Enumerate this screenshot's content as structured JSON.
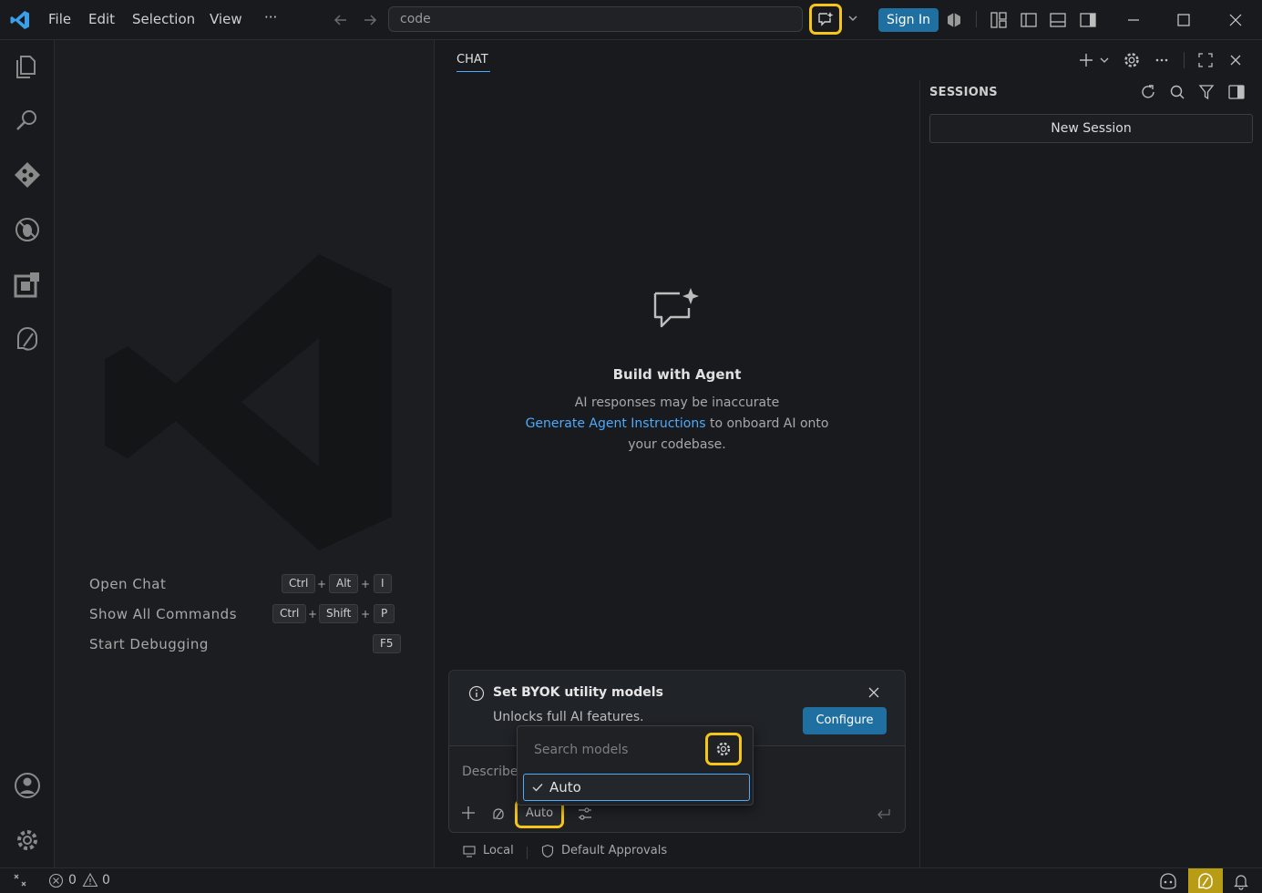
{
  "titlebar": {
    "menu": [
      "File",
      "Edit",
      "Selection",
      "View",
      "···"
    ],
    "search_text": "code",
    "sign_in_label": "Sign In"
  },
  "activity_bar": {
    "items": [
      "explorer-icon",
      "search-icon",
      "source-control-icon",
      "run-debug-icon",
      "extensions-icon",
      "copilot-icon"
    ],
    "bottom": [
      "account-icon",
      "manage-gear-icon"
    ]
  },
  "editor": {
    "shortcuts": [
      {
        "label": "Open Chat",
        "keys": [
          "Ctrl",
          "Alt",
          "I"
        ]
      },
      {
        "label": "Show All Commands",
        "keys": [
          "Ctrl",
          "Shift",
          "P"
        ]
      },
      {
        "label": "Start Debugging",
        "keys": [
          "F5"
        ]
      }
    ],
    "plus": "+"
  },
  "chat": {
    "tab_label": "CHAT",
    "empty_title": "Build with Agent",
    "empty_line1": "AI responses may be inaccurate",
    "empty_link": "Generate Agent Instructions",
    "empty_line2_rest": " to onboard AI onto",
    "empty_line3": "your codebase.",
    "notice": {
      "title": "Set BYOK utility models",
      "subtitle": "Unlocks full AI features.",
      "button": "Configure"
    },
    "input_placeholder": "Describe",
    "mode_label": "Auto",
    "model_picker": {
      "search_placeholder": "Search models",
      "options": [
        {
          "label": "Auto",
          "selected": true
        }
      ]
    },
    "footer": {
      "location": "Local",
      "approvals": "Default Approvals"
    }
  },
  "sessions": {
    "title": "SESSIONS",
    "new_session_label": "New Session"
  },
  "statusbar": {
    "errors": "0",
    "warnings": "0"
  },
  "colors": {
    "accent": "#4daafc",
    "button": "#1f6fa0",
    "highlight": "#f5c518",
    "background": "#181a1d"
  }
}
